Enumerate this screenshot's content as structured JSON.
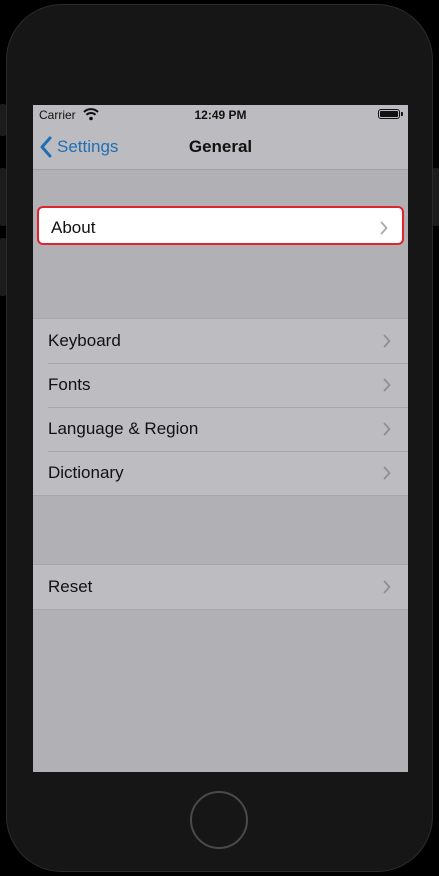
{
  "status_bar": {
    "carrier": "Carrier",
    "time": "12:49 PM"
  },
  "nav_bar": {
    "back_label": "Settings",
    "title": "General"
  },
  "groups": [
    {
      "items": [
        {
          "label": "About",
          "highlighted": true
        }
      ]
    },
    {
      "items": [
        {
          "label": "Keyboard"
        },
        {
          "label": "Fonts"
        },
        {
          "label": "Language & Region"
        },
        {
          "label": "Dictionary"
        }
      ]
    },
    {
      "items": [
        {
          "label": "Reset"
        }
      ]
    }
  ],
  "icons": {
    "back": "chevron-left-icon",
    "row": "chevron-right-icon",
    "wifi": "wifi-icon",
    "battery": "battery-icon"
  },
  "colors": {
    "accent": "#1f6fb6",
    "highlight_border": "#e0242f",
    "screen_bg": "#b1b1b5"
  }
}
